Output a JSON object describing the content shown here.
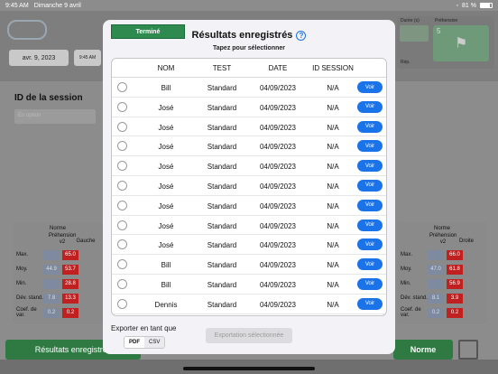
{
  "status_bar": {
    "time": "9:45 AM",
    "date": "Dimanche 9 avril",
    "battery": "81 %"
  },
  "background": {
    "date_button": "avr. 9, 2023",
    "time_button": "9:45 AM",
    "duration_label": "Durée (s)",
    "grip_label": "Préhension",
    "grip_value": "5",
    "rep_label": "Rép.",
    "session_label": "ID de la session",
    "session_placeholder": "En option",
    "left_card": {
      "title": "Norme",
      "subtitle": "Préhension v2",
      "side": "Gauche",
      "rows": [
        {
          "label": "Max.",
          "norm": "",
          "value": "65.0"
        },
        {
          "label": "Moy.",
          "norm": "44.9",
          "value": "53.7"
        },
        {
          "label": "Min.",
          "norm": "",
          "value": "28.8"
        },
        {
          "label": "Dév. stand.",
          "norm": "7.8",
          "value": "13.3"
        },
        {
          "label": "Coef. de var.",
          "norm": "0.2",
          "value": "0.2"
        }
      ]
    },
    "right_card": {
      "title": "Norme",
      "subtitle": "Préhension v2",
      "side": "Droite",
      "rows": [
        {
          "label": "Max.",
          "norm": "",
          "value": "66.0"
        },
        {
          "label": "Moy.",
          "norm": "47.0",
          "value": "61.8"
        },
        {
          "label": "Min.",
          "norm": "",
          "value": "56.9"
        },
        {
          "label": "Dév. stand.",
          "norm": "8.1",
          "value": "3.9"
        },
        {
          "label": "Coef. de var.",
          "norm": "0.2",
          "value": "0.2"
        }
      ]
    },
    "bottom_left_button": "Résultats enregistrés",
    "bottom_right_button": "Norme"
  },
  "modal": {
    "done_label": "Terminé",
    "title": "Résultats enregistrés",
    "subtitle": "Tapez pour sélectionner",
    "columns": {
      "nom": "NOM",
      "test": "TEST",
      "date": "DATE",
      "id": "ID SESSION"
    },
    "rows": [
      {
        "nom": "Bill",
        "test": "Standard",
        "date": "04/09/2023",
        "id": "N/A",
        "action": "Voir"
      },
      {
        "nom": "José",
        "test": "Standard",
        "date": "04/09/2023",
        "id": "N/A",
        "action": "Voir"
      },
      {
        "nom": "José",
        "test": "Standard",
        "date": "04/09/2023",
        "id": "N/A",
        "action": "Voir"
      },
      {
        "nom": "José",
        "test": "Standard",
        "date": "04/09/2023",
        "id": "N/A",
        "action": "Voir"
      },
      {
        "nom": "José",
        "test": "Standard",
        "date": "04/09/2023",
        "id": "N/A",
        "action": "Voir"
      },
      {
        "nom": "José",
        "test": "Standard",
        "date": "04/09/2023",
        "id": "N/A",
        "action": "Voir"
      },
      {
        "nom": "José",
        "test": "Standard",
        "date": "04/09/2023",
        "id": "N/A",
        "action": "Voir"
      },
      {
        "nom": "José",
        "test": "Standard",
        "date": "04/09/2023",
        "id": "N/A",
        "action": "Voir"
      },
      {
        "nom": "José",
        "test": "Standard",
        "date": "04/09/2023",
        "id": "N/A",
        "action": "Voir"
      },
      {
        "nom": "Bill",
        "test": "Standard",
        "date": "04/09/2023",
        "id": "N/A",
        "action": "Voir"
      },
      {
        "nom": "Bill",
        "test": "Standard",
        "date": "04/09/2023",
        "id": "N/A",
        "action": "Voir"
      },
      {
        "nom": "Dennis",
        "test": "Standard",
        "date": "04/09/2023",
        "id": "N/A",
        "action": "Voir"
      }
    ],
    "export_label": "Exporter en tant que",
    "format_options": [
      "PDF",
      "CSV"
    ],
    "selected_format": "PDF",
    "export_button": "Exportation sélectionnée"
  },
  "colors": {
    "accent": "#1a73e8",
    "done_green": "#2f8a4f",
    "alert_red": "#c02020"
  }
}
